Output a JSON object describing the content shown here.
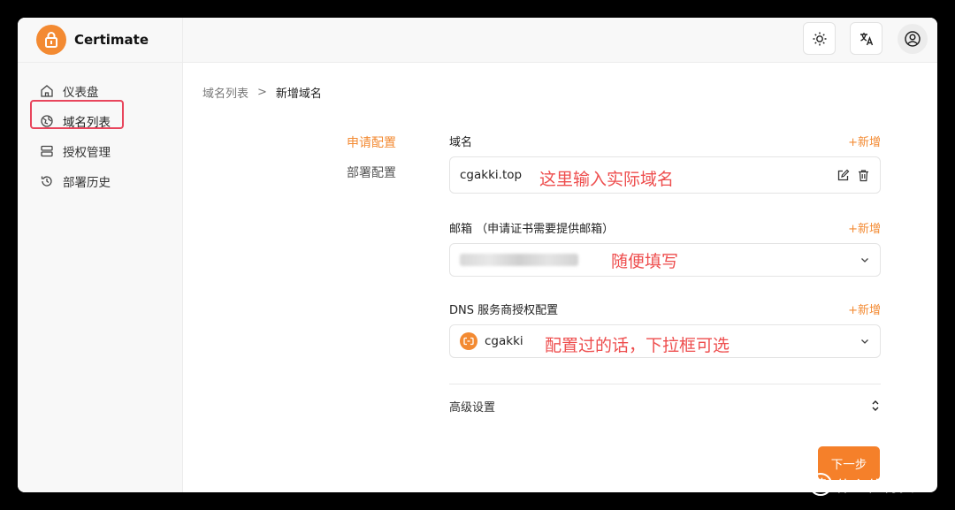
{
  "app": {
    "name": "Certimate"
  },
  "sidebar": {
    "items": [
      {
        "label": "仪表盘"
      },
      {
        "label": "域名列表"
      },
      {
        "label": "授权管理"
      },
      {
        "label": "部署历史"
      }
    ]
  },
  "breadcrumb": {
    "parent": "域名列表",
    "separator": ">",
    "current": "新增域名"
  },
  "steps": [
    {
      "label": "申请配置"
    },
    {
      "label": "部署配置"
    }
  ],
  "form": {
    "domain": {
      "label": "域名",
      "add": "+新增",
      "value": "cgakki.top",
      "note": "这里输入实际域名"
    },
    "email": {
      "label": "邮箱 （申请证书需要提供邮箱）",
      "add": "+新增",
      "note": "随便填写"
    },
    "dns": {
      "label": "DNS 服务商授权配置",
      "add": "+新增",
      "value": "cgakki",
      "note": "配置过的话，下拉框可选"
    },
    "advanced": {
      "label": "高级设置"
    }
  },
  "actions": {
    "next": "下一步"
  },
  "watermark": {
    "icon_text": "值",
    "text": "什么值得买"
  },
  "colors": {
    "accent": "#f38a32",
    "highlight": "#e8455c",
    "note": "#ee4e4e"
  }
}
